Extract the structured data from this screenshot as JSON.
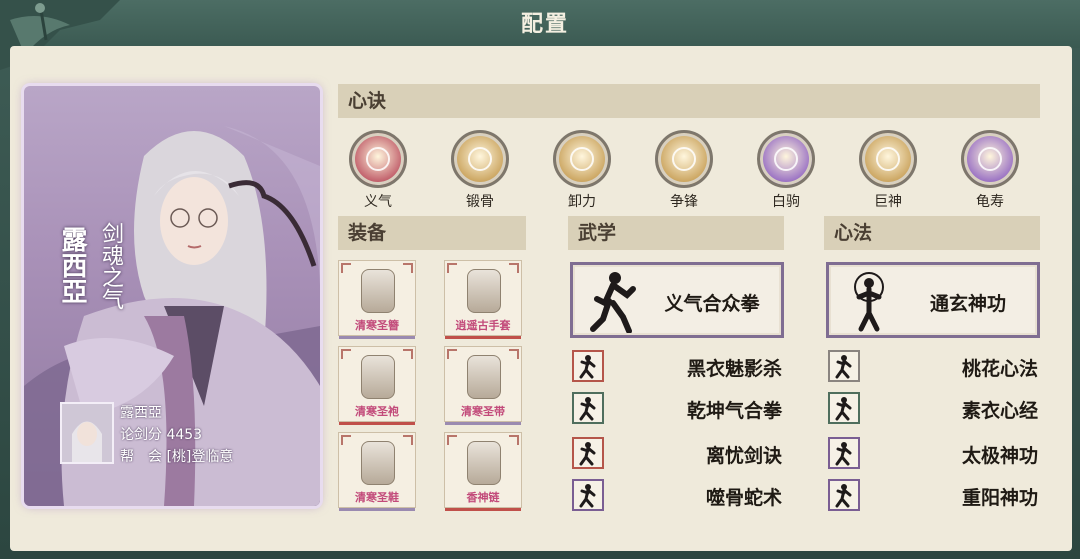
{
  "window": {
    "title": "配置"
  },
  "character": {
    "name": "露西亞",
    "title": "剑魂之气",
    "info_name": "露西亞",
    "score_label": "论剑分",
    "score_value": "4453",
    "guild_label": "帮　会",
    "guild_value": "[桃]登临意"
  },
  "sections": {
    "xinjue": "心诀",
    "equipment": "装备",
    "wuxue": "武学",
    "xinfa": "心法"
  },
  "xinjue": [
    {
      "label": "义气",
      "color": "#b8495a",
      "icon": "eye-sigil-icon"
    },
    {
      "label": "锻骨",
      "color": "#c49a4f",
      "icon": "wheel-sigil-icon"
    },
    {
      "label": "卸力",
      "color": "#c49a4f",
      "icon": "swirl-sigil-icon"
    },
    {
      "label": "争锋",
      "color": "#c49a4f",
      "icon": "fist-sigil-icon"
    },
    {
      "label": "白驹",
      "color": "#8c5fc0",
      "icon": "horse-sigil-icon"
    },
    {
      "label": "巨神",
      "color": "#c49a4f",
      "icon": "face-sigil-icon"
    },
    {
      "label": "龟寿",
      "color": "#8c5fc0",
      "icon": "shell-sigil-icon"
    }
  ],
  "equipment": [
    {
      "label": "清寒圣簪",
      "bar": "#9a8ab0"
    },
    {
      "label": "逍遥古手套",
      "bar": "#c0504a"
    },
    {
      "label": "清寒圣袍",
      "bar": "#c0504a"
    },
    {
      "label": "清寒圣带",
      "bar": "#9a8ab0"
    },
    {
      "label": "清寒圣鞋",
      "bar": "#9a8ab0"
    },
    {
      "label": "香神链",
      "bar": "#c0504a"
    }
  ],
  "wuxue": {
    "main": "义气合众拳",
    "items": [
      {
        "name": "黑衣魅影杀",
        "border": "#b5564a"
      },
      {
        "name": "乾坤气合拳",
        "border": "#4f6e5d"
      },
      {
        "name": "离忧剑诀",
        "border": "#b5564a"
      },
      {
        "name": "噬骨蛇术",
        "border": "#7a5e93"
      }
    ]
  },
  "xinfa": {
    "main": "通玄神功",
    "items": [
      {
        "name": "桃花心法",
        "border": "#8a8480"
      },
      {
        "name": "素衣心经",
        "border": "#4f6e5d"
      },
      {
        "name": "太极神功",
        "border": "#7a5e93"
      },
      {
        "name": "重阳神功",
        "border": "#7a5e93"
      }
    ]
  }
}
